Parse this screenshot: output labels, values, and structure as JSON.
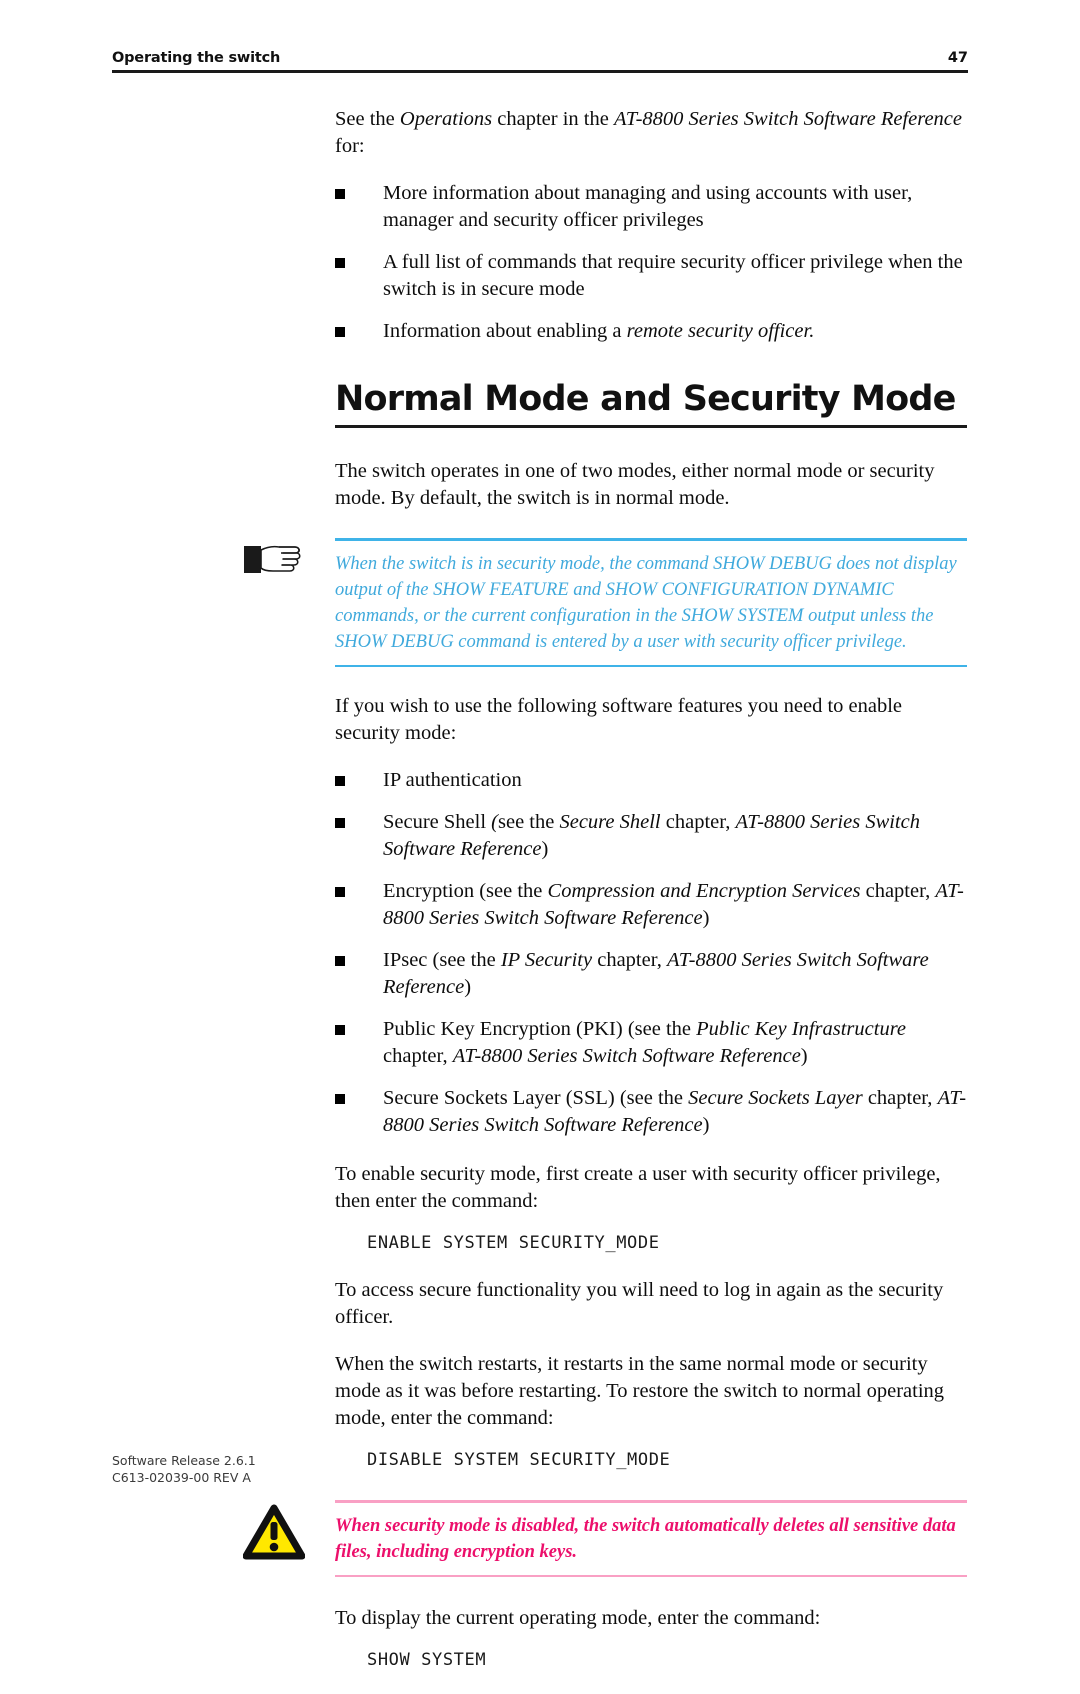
{
  "header": {
    "title": "Operating the switch",
    "page_number": "47"
  },
  "intro": {
    "lead_html": "See the <i>Operations</i> chapter in the <i>AT-8800 Series Switch Software Reference</i> for:",
    "bullets": [
      "More information about managing and using accounts with user, manager and security officer privileges",
      "A full list of commands that require security officer privilege when the switch is in secure mode",
      "Information about enabling a <i>remote security officer.</i>"
    ]
  },
  "section": {
    "heading": "Normal Mode and Security Mode",
    "intro_paragraph": "The switch operates in one of two modes, either normal mode or security mode. By default, the switch is in normal mode."
  },
  "note": {
    "icon": "pointing-hand-icon",
    "text": "When the switch is in security mode, the command SHOW DEBUG does not display output of the SHOW FEATURE and SHOW CONFIGURATION DYNAMIC commands, or the current configuration in the SHOW SYSTEM output unless the SHOW DEBUG command is entered by a user with security officer privilege.",
    "rule_color": "#3FB3E8",
    "text_color": "#3FA9DC"
  },
  "features": {
    "lead": "If you wish to use the following software features you need to enable security mode:",
    "bullets": [
      "IP authentication",
      "Secure Shell <i>(</i>see the <i>Secure Shell</i> chapter, <i>AT-8800 Series Switch Software Reference</i>)",
      "Encryption (see the <i>Compression and Encryption Services</i> chapter, <i>AT-8800 Series Switch Software Reference</i>)",
      "IPsec (see the <i>IP Security</i> chapter, <i>AT-8800 Series Switch Software Reference</i>)",
      "Public Key Encryption (PKI) (see the <i>Public Key Infrastructure</i> chapter, <i>AT-8800 Series Switch Software Reference</i>)",
      "Secure Sockets Layer (SSL) (see the <i>Secure Sockets Layer</i> chapter, <i>AT-8800 Series Switch Software Reference</i>)"
    ]
  },
  "enable": {
    "paragraph": "To enable security mode, first create a user with security officer privilege, then enter the command:",
    "command": "ENABLE SYSTEM SECURITY_MODE",
    "after_paragraph": "To access secure functionality you will need to log in again as the security officer."
  },
  "restart": {
    "paragraph": "When the switch restarts, it restarts in the same normal mode or security mode as it was before restarting. To restore the switch to normal operating mode, enter the command:",
    "command": "DISABLE SYSTEM SECURITY_MODE"
  },
  "warning": {
    "icon": "warning-triangle-icon",
    "text": "When security mode is disabled, the switch automatically deletes all sensitive data files, including encryption keys.",
    "rule_color": "#F9A0C4",
    "text_color": "#EC0F6B",
    "triangle_fill": "#FFE800"
  },
  "display": {
    "paragraph": "To display the current operating mode, enter the command:",
    "command": "SHOW SYSTEM"
  },
  "footer": {
    "release": "Software Release 2.6.1",
    "doc_id": "C613-02039-00 REV A"
  }
}
